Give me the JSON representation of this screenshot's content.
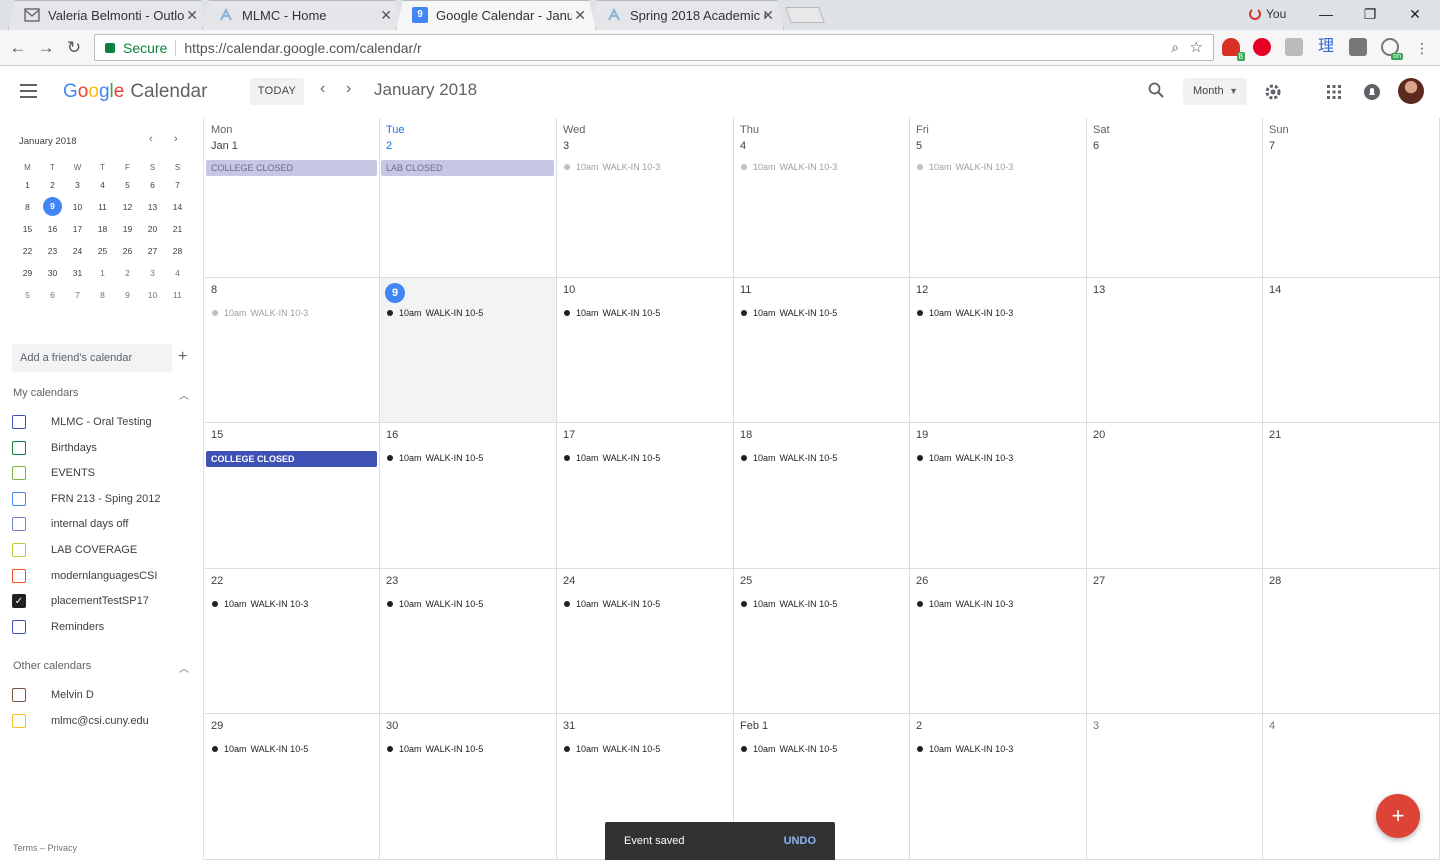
{
  "browser": {
    "tabs": [
      {
        "title": "Valeria Belmonti - Outlook",
        "icon": "outlook-icon"
      },
      {
        "title": "MLMC - Home",
        "icon": "mlmc-icon"
      },
      {
        "title": "Google Calendar - January 2018",
        "icon": "calendar-icon",
        "icon_text": "9",
        "active": true
      },
      {
        "title": "Spring 2018 Academic Calendar",
        "icon": "mlmc-icon"
      }
    ],
    "user_label": "You",
    "secure_label": "Secure",
    "url": "https://calendar.google.com/calendar/r",
    "extension_badges": [
      "8",
      "on"
    ],
    "extension_glyph": "理"
  },
  "header": {
    "logo_word": "Google",
    "product": "Calendar",
    "today_label": "TODAY",
    "title": "January 2018",
    "view_label": "Month"
  },
  "mini_calendar": {
    "title": "January 2018",
    "weekday_labels": [
      "M",
      "T",
      "W",
      "T",
      "F",
      "S",
      "S"
    ],
    "weeks": [
      [
        "1",
        "2",
        "3",
        "4",
        "5",
        "6",
        "7"
      ],
      [
        "8",
        "9",
        "10",
        "11",
        "12",
        "13",
        "14"
      ],
      [
        "15",
        "16",
        "17",
        "18",
        "19",
        "20",
        "21"
      ],
      [
        "22",
        "23",
        "24",
        "25",
        "26",
        "27",
        "28"
      ],
      [
        "29",
        "30",
        "31",
        "1",
        "2",
        "3",
        "4"
      ],
      [
        "5",
        "6",
        "7",
        "8",
        "9",
        "10",
        "11"
      ]
    ],
    "today": "9"
  },
  "sidebar": {
    "add_friend_placeholder": "Add a friend's calendar",
    "my_calendars_label": "My calendars",
    "my_calendars": [
      {
        "name": "MLMC - Oral Testing",
        "color": "#3f51b5",
        "checked": false
      },
      {
        "name": "Birthdays",
        "color": "#0b8043",
        "checked": false
      },
      {
        "name": "EVENTS",
        "color": "#7cb342",
        "checked": false
      },
      {
        "name": "FRN 213 - Sping 2012",
        "color": "#4285f4",
        "checked": false
      },
      {
        "name": "internal days off",
        "color": "#7986cb",
        "checked": false
      },
      {
        "name": "LAB COVERAGE",
        "color": "#c0ca33",
        "checked": false
      },
      {
        "name": "modernlanguagesCSI",
        "color": "#f4511e",
        "checked": false
      },
      {
        "name": "placementTestSP17",
        "color": "#202124",
        "checked": true
      },
      {
        "name": "Reminders",
        "color": "#3f51b5",
        "checked": false
      }
    ],
    "other_calendars_label": "Other calendars",
    "other_calendars": [
      {
        "name": "Melvin D",
        "color": "#795548",
        "checked": false
      },
      {
        "name": "mlmc@csi.cuny.edu",
        "color": "#f6bf26",
        "checked": false
      }
    ],
    "footer": "Terms – Privacy"
  },
  "month": {
    "weekdays": [
      "Mon",
      "Tue",
      "Wed",
      "Thu",
      "Fri",
      "Sat",
      "Sun"
    ],
    "weeks": [
      [
        {
          "label": "Jan 1",
          "allday": {
            "text": "COLLEGE CLOSED",
            "style": "past"
          }
        },
        {
          "label": "2",
          "allday": {
            "text": "LAB CLOSED",
            "style": "past"
          }
        },
        {
          "label": "3",
          "event": {
            "time": "10am",
            "title": "WALK-IN 10-3",
            "dim": true
          }
        },
        {
          "label": "4",
          "event": {
            "time": "10am",
            "title": "WALK-IN 10-3",
            "dim": true
          }
        },
        {
          "label": "5",
          "event": {
            "time": "10am",
            "title": "WALK-IN 10-3",
            "dim": true
          }
        },
        {
          "label": "6"
        },
        {
          "label": "7"
        }
      ],
      [
        {
          "label": "8",
          "event": {
            "time": "10am",
            "title": "WALK-IN 10-3",
            "dim": true
          }
        },
        {
          "label": "9",
          "today": true,
          "event": {
            "time": "10am",
            "title": "WALK-IN 10-5"
          }
        },
        {
          "label": "10",
          "event": {
            "time": "10am",
            "title": "WALK-IN 10-5"
          }
        },
        {
          "label": "11",
          "event": {
            "time": "10am",
            "title": "WALK-IN 10-5"
          }
        },
        {
          "label": "12",
          "event": {
            "time": "10am",
            "title": "WALK-IN 10-3"
          }
        },
        {
          "label": "13"
        },
        {
          "label": "14"
        }
      ],
      [
        {
          "label": "15",
          "allday": {
            "text": "COLLEGE CLOSED",
            "style": "now"
          }
        },
        {
          "label": "16",
          "event": {
            "time": "10am",
            "title": "WALK-IN 10-5"
          }
        },
        {
          "label": "17",
          "event": {
            "time": "10am",
            "title": "WALK-IN 10-5"
          }
        },
        {
          "label": "18",
          "event": {
            "time": "10am",
            "title": "WALK-IN 10-5"
          }
        },
        {
          "label": "19",
          "event": {
            "time": "10am",
            "title": "WALK-IN 10-3"
          }
        },
        {
          "label": "20"
        },
        {
          "label": "21"
        }
      ],
      [
        {
          "label": "22",
          "event": {
            "time": "10am",
            "title": "WALK-IN 10-3"
          }
        },
        {
          "label": "23",
          "event": {
            "time": "10am",
            "title": "WALK-IN 10-5"
          }
        },
        {
          "label": "24",
          "event": {
            "time": "10am",
            "title": "WALK-IN 10-5"
          }
        },
        {
          "label": "25",
          "event": {
            "time": "10am",
            "title": "WALK-IN 10-5"
          }
        },
        {
          "label": "26",
          "event": {
            "time": "10am",
            "title": "WALK-IN 10-3"
          }
        },
        {
          "label": "27"
        },
        {
          "label": "28"
        }
      ],
      [
        {
          "label": "29",
          "event": {
            "time": "10am",
            "title": "WALK-IN 10-5"
          }
        },
        {
          "label": "30",
          "event": {
            "time": "10am",
            "title": "WALK-IN 10-5"
          }
        },
        {
          "label": "31",
          "event": {
            "time": "10am",
            "title": "WALK-IN 10-5"
          }
        },
        {
          "label": "Feb 1",
          "event": {
            "time": "10am",
            "title": "WALK-IN 10-5"
          }
        },
        {
          "label": "2",
          "event": {
            "time": "10am",
            "title": "WALK-IN 10-3"
          }
        },
        {
          "label": "3",
          "other_month": true
        },
        {
          "label": "4",
          "other_month": true
        }
      ]
    ]
  },
  "snackbar": {
    "message": "Event saved",
    "action": "UNDO"
  },
  "fab": {
    "label": "+"
  }
}
